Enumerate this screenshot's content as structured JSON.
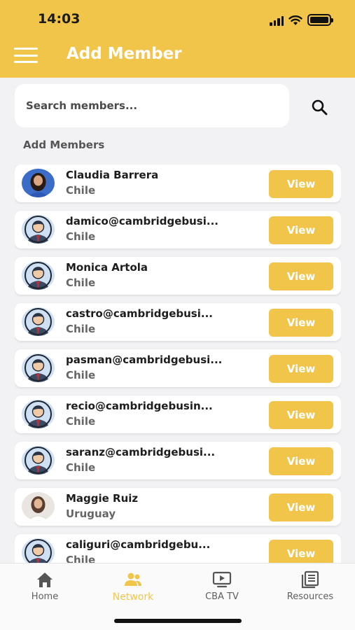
{
  "status_bar": {
    "time": "14:03"
  },
  "header": {
    "title": "Add Member"
  },
  "search": {
    "placeholder": "Search members..."
  },
  "section": {
    "label": "Add Members"
  },
  "members": [
    {
      "name": "Claudia Barrera",
      "country": "Chile",
      "avatar": "photo-woman-dark-hair-icon"
    },
    {
      "name": "damico@cambridgebusi...",
      "country": "Chile",
      "avatar": "default-user-icon"
    },
    {
      "name": "Monica Artola",
      "country": "Chile",
      "avatar": "default-user-icon"
    },
    {
      "name": "castro@cambridgebusi...",
      "country": "Chile",
      "avatar": "default-user-icon"
    },
    {
      "name": "pasman@cambridgebusi...",
      "country": "Chile",
      "avatar": "default-user-icon"
    },
    {
      "name": "recio@cambridgebusin...",
      "country": "Chile",
      "avatar": "default-user-icon"
    },
    {
      "name": "saranz@cambridgebusi...",
      "country": "Chile",
      "avatar": "default-user-icon"
    },
    {
      "name": "Maggie Ruiz",
      "country": "Uruguay",
      "avatar": "photo-woman-white-top-icon"
    },
    {
      "name": "caliguri@cambridgebu...",
      "country": "Chile",
      "avatar": "default-user-icon"
    }
  ],
  "view_label": "View",
  "tabs": [
    {
      "label": "Home",
      "icon": "home-icon",
      "active": false
    },
    {
      "label": "Network",
      "icon": "people-icon",
      "active": true
    },
    {
      "label": "CBA TV",
      "icon": "tv-play-icon",
      "active": false
    },
    {
      "label": "Resources",
      "icon": "book-icon",
      "active": false
    }
  ],
  "colors": {
    "accent": "#f1c54a",
    "background": "#f2f2f4",
    "default_avatar_bg": "#cfe0f4"
  }
}
